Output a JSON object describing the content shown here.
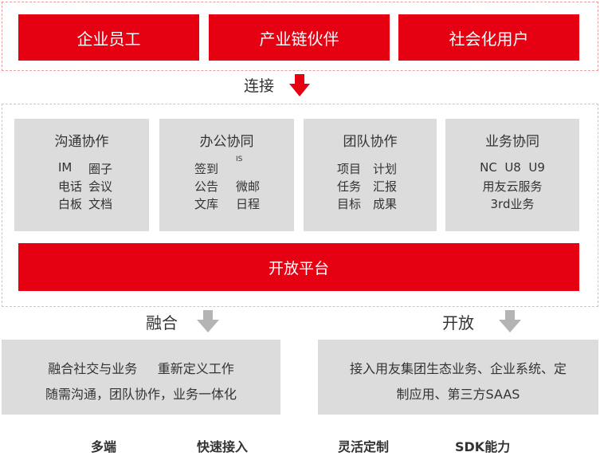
{
  "users": {
    "items": [
      {
        "label": "企业员工"
      },
      {
        "label": "产业链伙伴"
      },
      {
        "label": "社会化用户"
      }
    ]
  },
  "connect_label": "连接",
  "modules": [
    {
      "title": "沟通协作",
      "rows": [
        [
          "IM",
          "圈子"
        ],
        [
          "电话",
          "会议"
        ],
        [
          "白板",
          "文档"
        ]
      ]
    },
    {
      "title": "办公协同",
      "rows": [
        [
          "签到",
          "IS"
        ],
        [
          "公告",
          "微邮"
        ],
        [
          "文库",
          "日程"
        ]
      ]
    },
    {
      "title": "团队协作",
      "rows": [
        [
          "项目",
          "计划"
        ],
        [
          "任务",
          "汇报"
        ],
        [
          "目标",
          "成果"
        ]
      ]
    },
    {
      "title": "业务协同",
      "lines": [
        "NC  U8  U9",
        "用友云服务",
        "3rd业务"
      ]
    }
  ],
  "platform_label": "开放平台",
  "fusion": {
    "label": "融合",
    "lines": [
      "融合社交与业务     重新定义工作",
      "随需沟通，团队协作，业务一体化"
    ]
  },
  "open": {
    "label": "开放",
    "lines": [
      "接入用友集团生态业务、企业系统、定",
      "制应用、第三方SAAS"
    ]
  },
  "features": [
    "多端",
    "快速接入",
    "灵活定制",
    "SDK能力"
  ],
  "colors": {
    "brand_red": "#e50012",
    "module_gray": "#dcdcdc",
    "arrow_gray": "#b4b4b4"
  }
}
